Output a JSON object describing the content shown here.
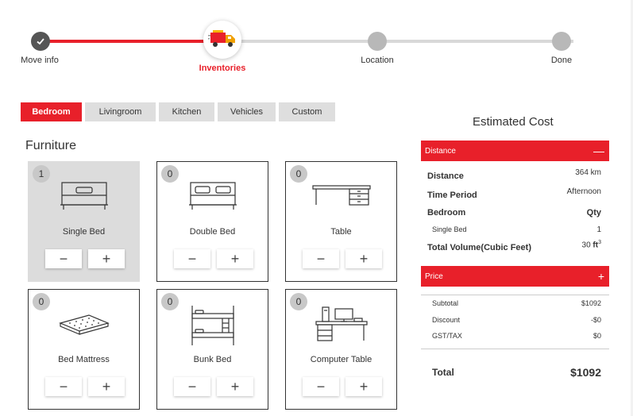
{
  "stepper": {
    "steps": [
      {
        "label": "Move info",
        "state": "done"
      },
      {
        "label": "Inventories",
        "state": "active"
      },
      {
        "label": "Location",
        "state": "future"
      },
      {
        "label": "Done",
        "state": "future"
      }
    ]
  },
  "tabs": [
    {
      "label": "Bedroom",
      "active": true
    },
    {
      "label": "Livingroom",
      "active": false
    },
    {
      "label": "Kitchen",
      "active": false
    },
    {
      "label": "Vehicles",
      "active": false
    },
    {
      "label": "Custom",
      "active": false
    }
  ],
  "section_title": "Furniture",
  "items": [
    {
      "name": "Single Bed",
      "count": "1",
      "icon": "single-bed-icon",
      "selected": true
    },
    {
      "name": "Double Bed",
      "count": "0",
      "icon": "double-bed-icon",
      "selected": false
    },
    {
      "name": "Table",
      "count": "0",
      "icon": "table-icon",
      "selected": false
    },
    {
      "name": "Bed Mattress",
      "count": "0",
      "icon": "mattress-icon",
      "selected": false
    },
    {
      "name": "Bunk Bed",
      "count": "0",
      "icon": "bunk-bed-icon",
      "selected": false
    },
    {
      "name": "Computer Table",
      "count": "0",
      "icon": "computer-table-icon",
      "selected": false
    }
  ],
  "qty_buttons": {
    "minus": "−",
    "plus": "+"
  },
  "estimate": {
    "title": "Estimated Cost",
    "distance_bar": {
      "label": "Distance",
      "toggle": "—"
    },
    "distance": {
      "label": "Distance",
      "value": "364 km"
    },
    "time_period": {
      "label": "Time Period",
      "value": "Afternoon"
    },
    "bedroom_header": {
      "label": "Bedroom",
      "value": "Qty"
    },
    "single_bed": {
      "label": "Single Bed",
      "value": "1"
    },
    "total_volume": {
      "label": "Total Volume(Cubic Feet)",
      "value": "30",
      "unit": "ft",
      "exp": "3"
    },
    "price_bar": {
      "label": "Price",
      "toggle": "+"
    },
    "subtotal": {
      "label": "Subtotal",
      "value": "$1092"
    },
    "discount": {
      "label": "Discount",
      "value": "-$0"
    },
    "gst": {
      "label": "GST/TAX",
      "value": "$0"
    },
    "total": {
      "label": "Total",
      "value": "$1092"
    }
  },
  "colors": {
    "accent": "#e8202a",
    "tab_inactive": "#dedede",
    "step_future": "#b8b8b8",
    "step_done": "#555555"
  }
}
